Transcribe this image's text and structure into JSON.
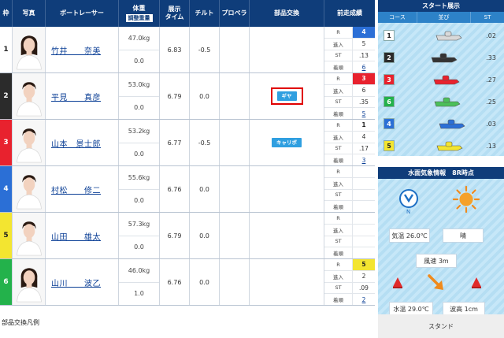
{
  "headers": {
    "waku": "枠",
    "photo": "写真",
    "racer": "ボートレーサー",
    "weight": "体重",
    "weight_sub": "調整重量",
    "time_1": "展示",
    "time_2": "タイム",
    "tilt": "チルト",
    "propeller": "プロペラ",
    "parts": "部品交換",
    "prev": "前走成績"
  },
  "prev_labels": {
    "course": "R",
    "entry": "進入",
    "st": "ST",
    "finish": "着順"
  },
  "racers": [
    {
      "waku": "1",
      "name": "竹井　　奈美",
      "weight": "47.0kg",
      "adjust": "0.0",
      "time": "6.83",
      "tilt": "-0.5",
      "part": "",
      "boxed": false,
      "r": "4",
      "entry": "5",
      "st": ".13",
      "finish": "6",
      "color": "#ffffff",
      "text": "#222222",
      "photo": "woman"
    },
    {
      "waku": "2",
      "name": "平見　　真彦",
      "weight": "53.0kg",
      "adjust": "0.0",
      "time": "6.79",
      "tilt": "0.0",
      "part": "ギヤ",
      "boxed": true,
      "r": "3",
      "entry": "6",
      "st": ".35",
      "finish": "5",
      "color": "#2b2b2b",
      "text": "#ffffff",
      "photo": "man"
    },
    {
      "waku": "3",
      "name": "山本　景士郎",
      "weight": "53.2kg",
      "adjust": "0.0",
      "time": "6.77",
      "tilt": "-0.5",
      "part": "キャリボ",
      "boxed": false,
      "r": "1",
      "entry": "4",
      "st": ".17",
      "finish": "3",
      "color": "#e8222e",
      "text": "#ffffff",
      "photo": "man"
    },
    {
      "waku": "4",
      "name": "村松　　修二",
      "weight": "55.6kg",
      "adjust": "0.0",
      "time": "6.76",
      "tilt": "0.0",
      "part": "",
      "boxed": false,
      "r": "",
      "entry": "",
      "st": "",
      "finish": "",
      "color": "#2b6fd6",
      "text": "#ffffff",
      "photo": "man"
    },
    {
      "waku": "5",
      "name": "山田　　雄太",
      "weight": "57.3kg",
      "adjust": "0.0",
      "time": "6.79",
      "tilt": "0.0",
      "part": "",
      "boxed": false,
      "r": "",
      "entry": "",
      "st": "",
      "finish": "",
      "color": "#f3e530",
      "text": "#222222",
      "photo": "man"
    },
    {
      "waku": "6",
      "name": "山川　　波乙",
      "weight": "46.0kg",
      "adjust": "1.0",
      "time": "6.76",
      "tilt": "0.0",
      "part": "",
      "boxed": false,
      "r": "5",
      "entry": "2",
      "st": ".09",
      "finish": "2",
      "color": "#23b24b",
      "text": "#ffffff",
      "photo": "woman"
    }
  ],
  "legend_title": "部品交換凡例",
  "start": {
    "title": "スタート展示",
    "col_course": "コース",
    "col_order": "並び",
    "col_st": "ST",
    "lanes": [
      {
        "num": "1",
        "st": ".02",
        "color": "#ffffff",
        "text": "#222222",
        "boat": "#d9d9d9",
        "offset": 0.55
      },
      {
        "num": "2",
        "st": ".33",
        "color": "#2b2b2b",
        "text": "#ffffff",
        "boat": "#333333",
        "offset": 0.45
      },
      {
        "num": "3",
        "st": ".27",
        "color": "#e8222e",
        "text": "#ffffff",
        "boat": "#e8222e",
        "offset": 0.5
      },
      {
        "num": "6",
        "st": ".25",
        "color": "#23b24b",
        "text": "#ffffff",
        "boat": "#4cbf5a",
        "offset": 0.52
      },
      {
        "num": "4",
        "st": ".03",
        "color": "#2b6fd6",
        "text": "#ffffff",
        "boat": "#2b6fd6",
        "offset": 0.62
      },
      {
        "num": "5",
        "st": ".13",
        "color": "#f3e530",
        "text": "#222222",
        "boat": "#f3e530",
        "offset": 0.56
      }
    ]
  },
  "weather": {
    "title": "水面気象情報　8R時点",
    "wind_dir_label": "N",
    "air_temp": "気温 26.0℃",
    "condition": "晴",
    "wind_speed": "風速 3m",
    "water_temp": "水温 29.0℃",
    "wave_height": "波高 1cm",
    "stand": "スタンド"
  }
}
